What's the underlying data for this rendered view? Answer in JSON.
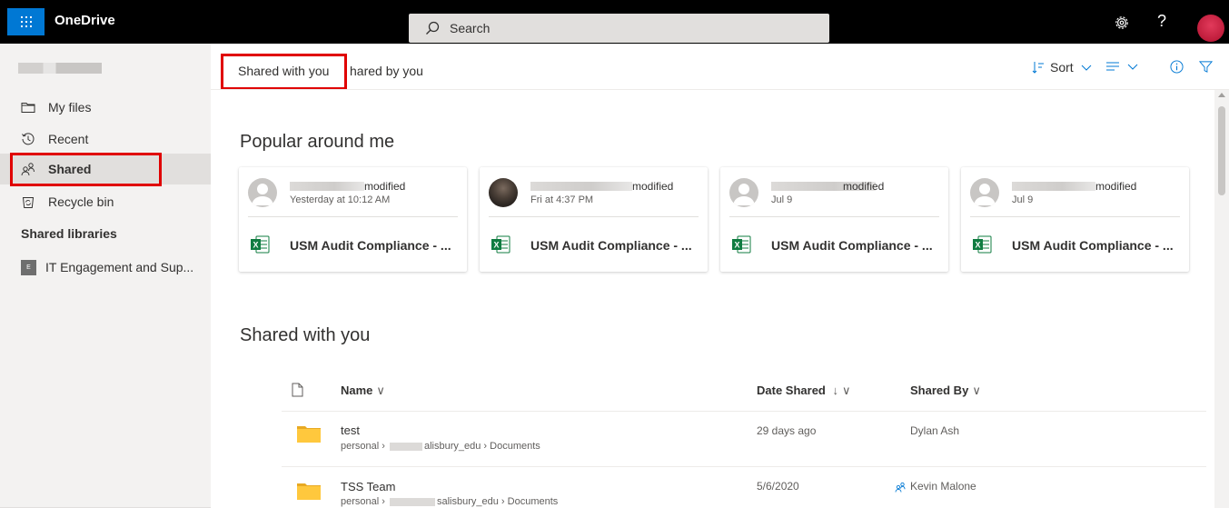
{
  "topbar": {
    "app_name": "OneDrive",
    "search_placeholder": "Search",
    "help_label": "?"
  },
  "sidebar": {
    "items": [
      {
        "label": "My files",
        "icon": "folder-icon"
      },
      {
        "label": "Recent",
        "icon": "clock-icon"
      },
      {
        "label": "Shared",
        "icon": "people-icon",
        "active": true
      },
      {
        "label": "Recycle bin",
        "icon": "recycle-bin-icon"
      }
    ],
    "libraries_heading": "Shared libraries",
    "libraries": [
      {
        "badge": "E",
        "label": "IT Engagement and Sup..."
      }
    ]
  },
  "cmdbar": {
    "tabs": [
      "Shared with you",
      "hared by you"
    ],
    "sort_label": "Sort"
  },
  "popular": {
    "title": "Popular around me",
    "cards": [
      {
        "action": "modified",
        "time": "Yesterday at 10:12 AM",
        "file": "USM Audit Compliance - ..."
      },
      {
        "action": "modified",
        "time": "Fri at 4:37 PM",
        "file": "USM Audit Compliance - ..."
      },
      {
        "action": "modified",
        "time": "Jul 9",
        "file": "USM Audit Compliance - ..."
      },
      {
        "action": "modified",
        "time": "Jul 9",
        "file": "USM Audit Compliance - ..."
      }
    ]
  },
  "shared": {
    "title": "Shared with you",
    "columns": {
      "name": "Name",
      "date": "Date Shared",
      "date_sort": "↓",
      "by": "Shared By"
    },
    "rows": [
      {
        "name": "test",
        "path_start": "personal ›",
        "path_end": "alisbury_edu › Documents",
        "date": "29 days ago",
        "by": "Dylan Ash"
      },
      {
        "name": "TSS Team",
        "path_start": "personal ›",
        "path_end": "salisbury_edu › Documents",
        "date": "5/6/2020",
        "by": "Kevin Malone"
      }
    ]
  },
  "colors": {
    "accent": "#0078d4",
    "topbar": "#000000",
    "sidebar": "#f3f2f1",
    "highlight": "#e00000",
    "excel": "#107c41",
    "folder": "#ffc83d"
  }
}
